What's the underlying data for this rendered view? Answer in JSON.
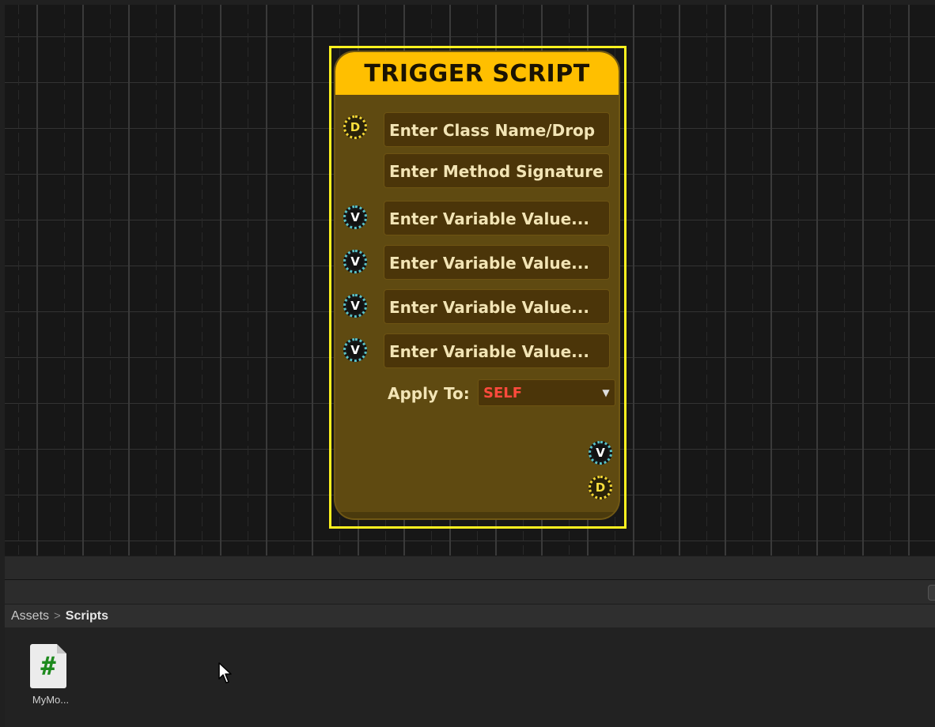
{
  "node": {
    "title": "TRIGGER SCRIPT",
    "fields": {
      "class_name": "Enter Class Name/Drop",
      "method_signature": "Enter Method Signature",
      "variable_1": "Enter Variable Value...",
      "variable_2": "Enter Variable Value...",
      "variable_3": "Enter Variable Value...",
      "variable_4": "Enter Variable Value..."
    },
    "apply_to": {
      "label": "Apply To:",
      "value": "SELF"
    },
    "ports": {
      "d_letter": "D",
      "v_letter": "V"
    },
    "colors": {
      "header": "#ffbf00",
      "body": "#5f4a11",
      "selection": "#fff21f",
      "apply_value": "#ff4a3d"
    }
  },
  "project": {
    "breadcrumb": {
      "root": "Assets",
      "separator": ">",
      "current": "Scripts"
    },
    "assets": [
      {
        "name": "MyMo...",
        "icon": "csharp-script-icon",
        "glyph": "#"
      }
    ]
  }
}
